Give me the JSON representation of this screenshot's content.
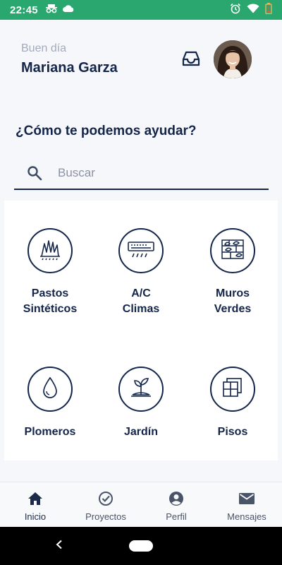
{
  "status_bar": {
    "time": "22:45",
    "left_icons": [
      "incognito-icon",
      "cloud-icon"
    ],
    "right_icons": [
      "alarm-icon",
      "wifi-icon",
      "battery-low-icon"
    ]
  },
  "header": {
    "greeting": "Buen día",
    "user_name": "Mariana Garza",
    "inbox_icon": "inbox-icon",
    "avatar": "user-avatar"
  },
  "help_title": "¿Cómo te podemos ayudar?",
  "search": {
    "placeholder": "Buscar",
    "value": "",
    "icon": "search-icon"
  },
  "services": [
    {
      "label": "Pastos\nSintéticos",
      "icon": "grass-icon"
    },
    {
      "label": "A/C\nClimas",
      "icon": "air-conditioner-icon"
    },
    {
      "label": "Muros\nVerdes",
      "icon": "green-wall-icon"
    },
    {
      "label": "Plomeros",
      "icon": "water-drop-icon"
    },
    {
      "label": "Jardín",
      "icon": "sprout-icon"
    },
    {
      "label": "Pisos",
      "icon": "floor-tiles-icon"
    }
  ],
  "bottom_nav": [
    {
      "label": "Inicio",
      "icon": "home-icon",
      "active": true
    },
    {
      "label": "Proyectos",
      "icon": "check-circle-icon",
      "active": false
    },
    {
      "label": "Perfil",
      "icon": "account-circle-icon",
      "active": false
    },
    {
      "label": "Mensajes",
      "icon": "mail-icon",
      "active": false
    }
  ],
  "colors": {
    "status_bar": "#2aa76e",
    "primary_text": "#14254a",
    "muted_text": "#a3aabb",
    "background": "#f6f7fb"
  }
}
